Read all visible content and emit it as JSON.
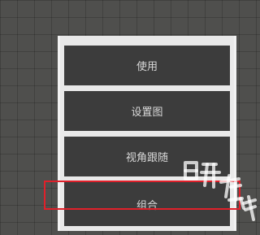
{
  "menu": {
    "items": [
      {
        "label": "使用"
      },
      {
        "label": "设置图"
      },
      {
        "label": "视角跟随"
      },
      {
        "label": "组合"
      }
    ],
    "highlighted_index": 3
  },
  "highlight": {
    "color": "#e0202a"
  },
  "watermark": {
    "text": "日升在线"
  }
}
